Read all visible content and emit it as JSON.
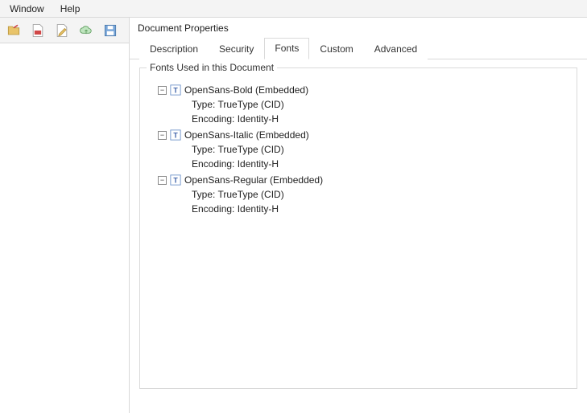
{
  "menubar": {
    "window": "Window",
    "help": "Help"
  },
  "dialog": {
    "title": "Document Properties",
    "tabs": {
      "description": "Description",
      "security": "Security",
      "fonts": "Fonts",
      "custom": "Custom",
      "advanced": "Advanced"
    },
    "group_label": "Fonts Used in this Document",
    "fonts": [
      {
        "name": "OpenSans-Bold (Embedded)",
        "type": "Type: TrueType (CID)",
        "encoding": "Encoding: Identity-H",
        "expander": "−"
      },
      {
        "name": "OpenSans-Italic (Embedded)",
        "type": "Type: TrueType (CID)",
        "encoding": "Encoding: Identity-H",
        "expander": "−"
      },
      {
        "name": "OpenSans-Regular (Embedded)",
        "type": "Type: TrueType (CID)",
        "encoding": "Encoding: Identity-H",
        "expander": "−"
      }
    ]
  }
}
